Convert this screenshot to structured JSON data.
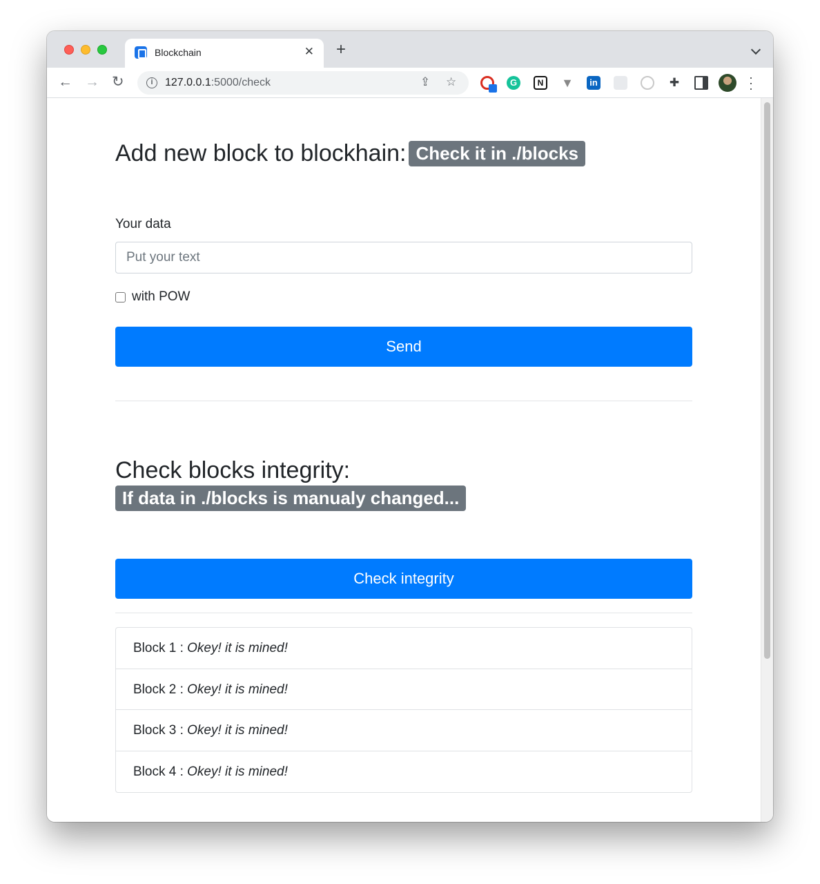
{
  "browser": {
    "tab_title": "Blockchain",
    "tab_close_glyph": "✕",
    "new_tab_glyph": "+",
    "url_host": "127.0.0.1",
    "url_path": ":5000/check",
    "extensions": [
      "G",
      "N",
      "in"
    ]
  },
  "add_section": {
    "title": "Add new block to blockhain:",
    "badge": "Check it in ./blocks",
    "data_label": "Your data",
    "input_placeholder": "Put your text",
    "input_value": "",
    "pow_label": "with POW",
    "pow_checked": false,
    "send_label": "Send"
  },
  "check_section": {
    "title": "Check blocks integrity:",
    "badge": "If data in ./blocks is manualy changed...",
    "check_label": "Check integrity"
  },
  "results": [
    {
      "block": "Block 1 : ",
      "status": "Okey! it is mined!"
    },
    {
      "block": "Block 2 : ",
      "status": "Okey! it is mined!"
    },
    {
      "block": "Block 3 : ",
      "status": "Okey! it is mined!"
    },
    {
      "block": "Block 4 : ",
      "status": "Okey! it is mined!"
    }
  ],
  "colors": {
    "primary": "#007bff",
    "badge": "#6c757d",
    "text": "#212529"
  }
}
